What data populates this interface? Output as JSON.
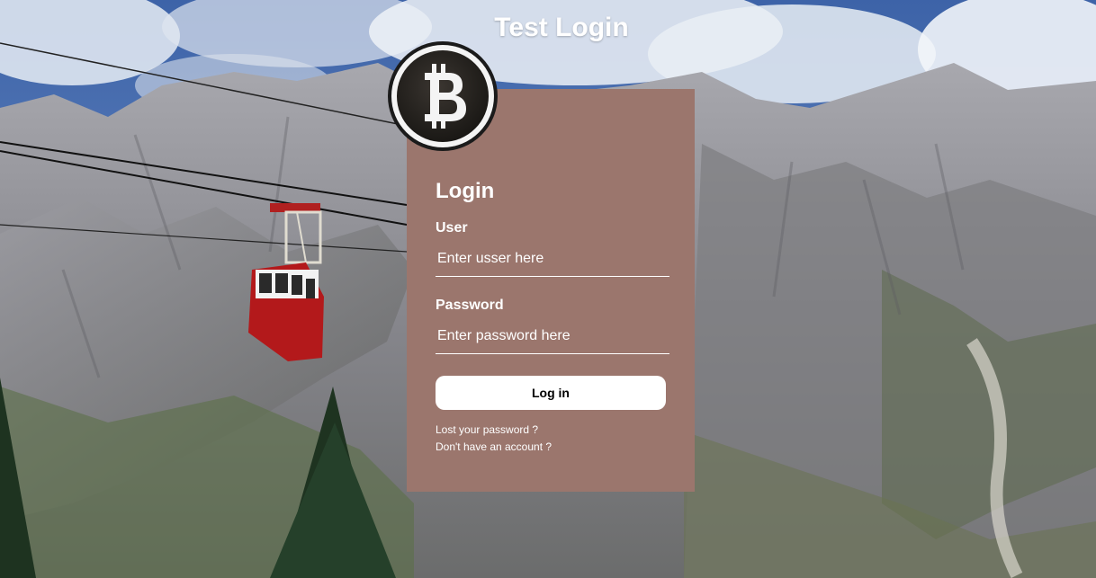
{
  "header": {
    "title": "Test Login"
  },
  "logo": {
    "icon": "bitcoin-icon",
    "glyph": "B"
  },
  "login": {
    "heading": "Login",
    "user_label": "User",
    "user_placeholder": "Enter usser here",
    "password_label": "Password",
    "password_placeholder": "Enter password here",
    "submit_label": "Log in",
    "lost_password_link": "Lost your password ?",
    "signup_link": "Don't have an account ?"
  },
  "colors": {
    "card_background": "#9b766d",
    "text": "#ffffff",
    "button_background": "#ffffff"
  }
}
